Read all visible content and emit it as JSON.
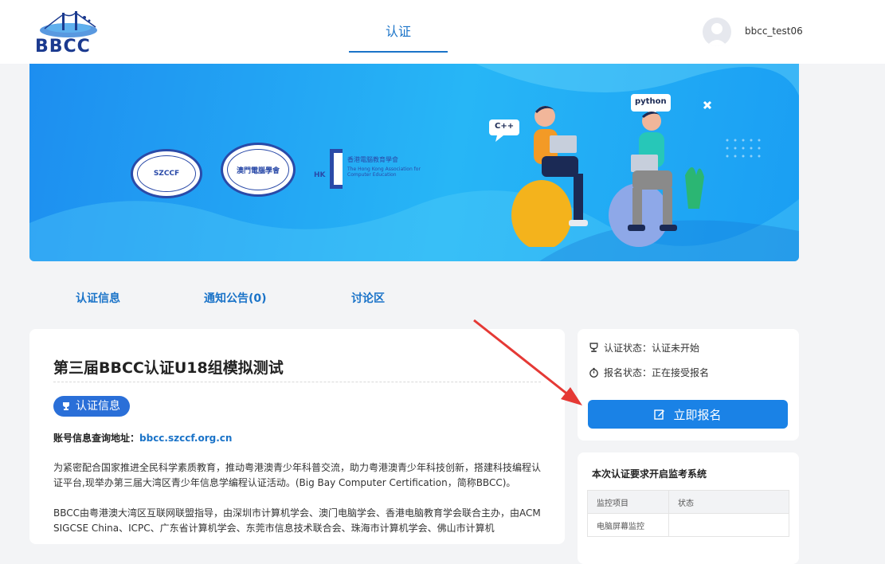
{
  "header": {
    "logo_text": "BBCC",
    "nav_tab": "认证",
    "username": "bbcc_test06"
  },
  "banner": {
    "seal1_text": "SZCCF",
    "seal2_text": "澳門電腦學會",
    "hkace_short": "HK",
    "hkace_name_zh": "香港電腦教育學會",
    "hkace_name_en": "The Hong Kong Association for Computer Education",
    "bubble_cpp": "C++",
    "bubble_python": "python"
  },
  "tabs": [
    {
      "label": "认证信息"
    },
    {
      "label": "通知公告(0)"
    },
    {
      "label": "讨论区"
    }
  ],
  "main": {
    "title": "第三届BBCC认证U18组模拟测试",
    "badge": "认证信息",
    "acct_label": "账号信息查询地址：",
    "acct_link": "bbcc.szccf.org.cn",
    "para1": "为紧密配合国家推进全民科学素质教育，推动粤港澳青少年科普交流，助力粤港澳青少年科技创新，搭建科技编程认证平台,现举办第三届大湾区青少年信息学编程认证活动。(Big Bay Computer Certification，简称BBCC)。",
    "para2": "BBCC由粤港澳大湾区互联网联盟指导，由深圳市计算机学会、澳门电脑学会、香港电脑教育学会联合主办，由ACM SIGCSE China、ICPC、广东省计算机学会、东莞市信息技术联合会、珠海市计算机学会、佛山市计算机"
  },
  "status": {
    "cert_status": "认证状态：认证未开始",
    "signup_status": "报名状态：正在接受报名",
    "signup_button": "立即报名"
  },
  "requirements": {
    "title": "本次认证要求开启监考系统",
    "col_item": "监控项目",
    "col_status": "状态",
    "rows": [
      {
        "item": "电脑屏幕监控",
        "status": ""
      }
    ]
  },
  "colors": {
    "accent": "#1a73c8",
    "button": "#1a82e6",
    "arrow": "#e53935"
  }
}
